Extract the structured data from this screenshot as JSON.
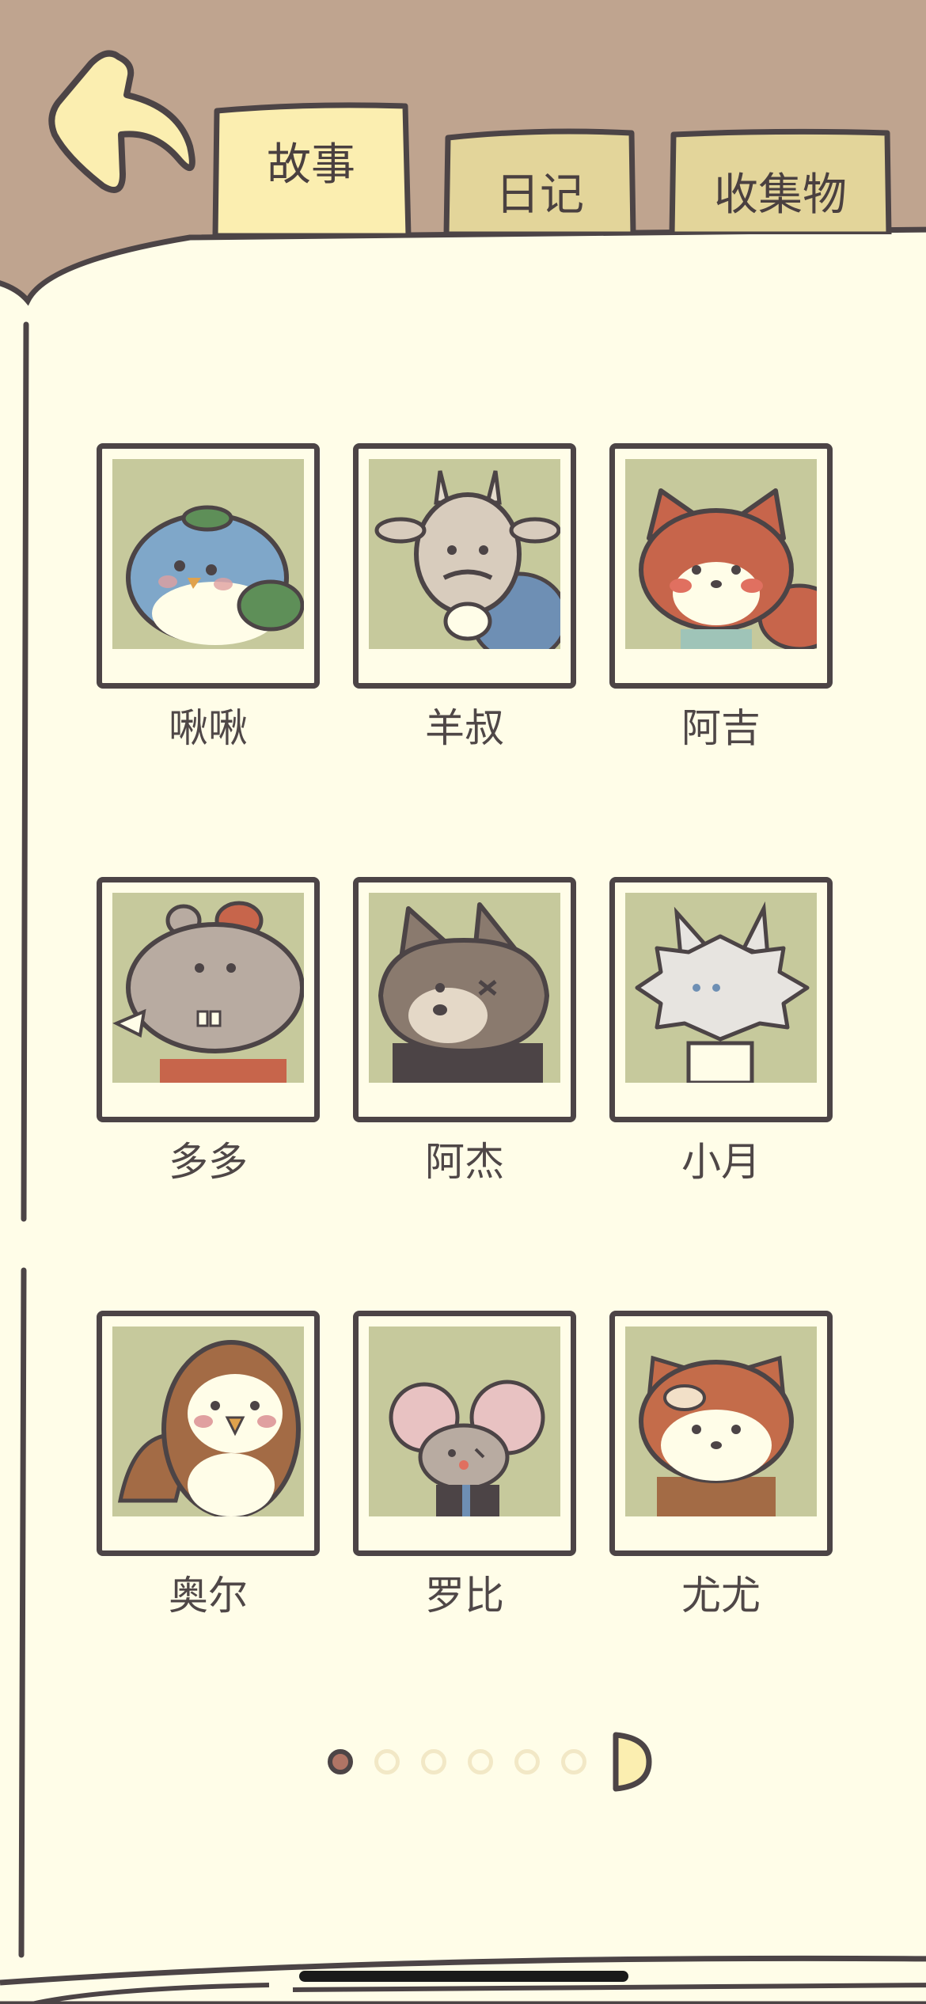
{
  "tabs": [
    {
      "label": "故事",
      "active": true
    },
    {
      "label": "日记",
      "active": false
    },
    {
      "label": "收集物",
      "active": false
    }
  ],
  "characters": [
    {
      "name": "啾啾",
      "animal": "bluebird"
    },
    {
      "name": "羊叔",
      "animal": "goat"
    },
    {
      "name": "阿吉",
      "animal": "fox"
    },
    {
      "name": "多多",
      "animal": "hippo"
    },
    {
      "name": "阿杰",
      "animal": "wolf"
    },
    {
      "name": "小月",
      "animal": "white-fluffy"
    },
    {
      "name": "奥尔",
      "animal": "owl"
    },
    {
      "name": "罗比",
      "animal": "mouse"
    },
    {
      "name": "尤尤",
      "animal": "red-panda"
    }
  ],
  "pagination": {
    "total_pages": 6,
    "current_page": 1
  },
  "colors": {
    "page_bg": "#fffde8",
    "header_bg": "#bfa48f",
    "tab_active": "#fbeeb0",
    "tab_inactive": "#e3d59a",
    "outline": "#4c4446",
    "portrait_bg": "#c6c99c",
    "dot_active": "#b07465",
    "dot_inactive": "#f2e8c6"
  },
  "icons": {
    "back": "curved-back-arrow-icon",
    "next": "half-circle-next-icon"
  }
}
